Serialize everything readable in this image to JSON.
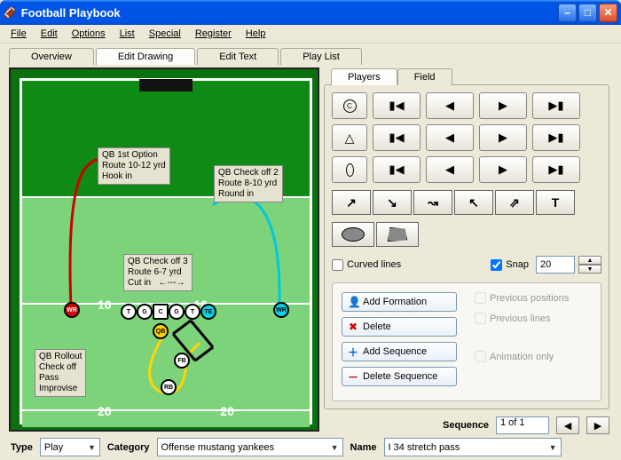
{
  "window": {
    "title": "Football Playbook"
  },
  "menu": [
    "File",
    "Edit",
    "Options",
    "List",
    "Special",
    "Register",
    "Help"
  ],
  "tabs": [
    "Overview",
    "Edit Drawing",
    "Edit Text",
    "Play List"
  ],
  "active_tab": 1,
  "inner_tabs": [
    "Players",
    "Field"
  ],
  "active_inner": 0,
  "yard_numbers": {
    "top_left": "10",
    "top_right": "10",
    "bot_left": "20",
    "bot_right": "20"
  },
  "annotations": {
    "a1": "QB 1st Option\nRoute 10-12 yrd\nHook in",
    "a2": "QB Check off 2\nRoute 8-10 yrd\nRound in",
    "a3": "QB Check off 3\nRoute 6-7 yrd\nCut in   ←---→",
    "a4": "QB Rollout\nCheck off\nPass\nImprovise"
  },
  "players": {
    "wr": "WR",
    "t1": "T",
    "g1": "G",
    "c": "C",
    "g2": "G",
    "t2": "T",
    "te": "TE",
    "qb": "QB",
    "fb": "FB",
    "rb": "RB",
    "wr2": "WR"
  },
  "tool_labels": [
    "↗",
    "↘",
    "↝",
    "↖",
    "⇗",
    "T"
  ],
  "checks": {
    "curved": "Curved lines",
    "snap": "Snap",
    "snap_val": "20"
  },
  "actions": {
    "add_formation": "Add Formation",
    "delete": "Delete",
    "add_seq": "Add Sequence",
    "del_seq": "Delete Sequence"
  },
  "gray": {
    "prev_pos": "Previous positions",
    "prev_lines": "Previous lines",
    "anim": "Animation only"
  },
  "sequence": {
    "label": "Sequence",
    "value": "1 of 1"
  },
  "bottom": {
    "type_label": "Type",
    "type_val": "Play",
    "cat_label": "Category",
    "cat_val": "Offense mustang yankees",
    "name_label": "Name",
    "name_val": "I 34 stretch pass"
  }
}
